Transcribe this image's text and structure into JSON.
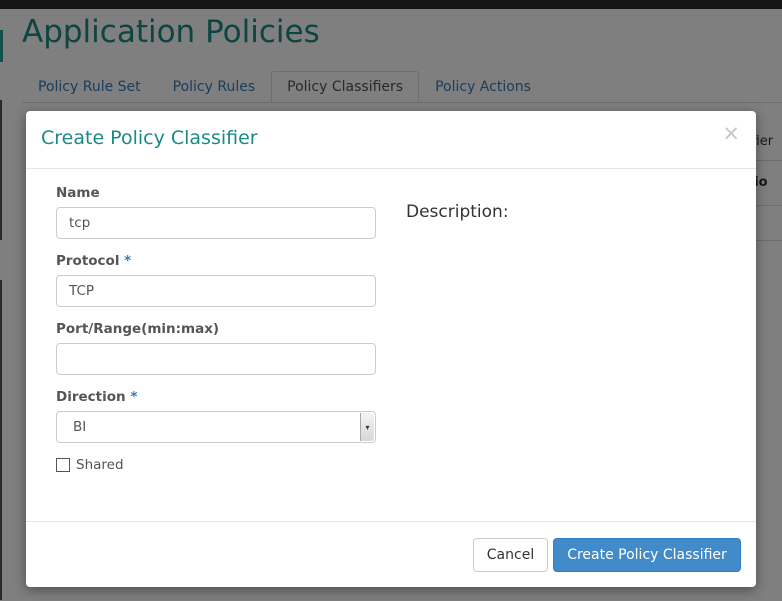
{
  "page": {
    "title": "Application Policies",
    "tabs": [
      {
        "label": "Policy Rule Set"
      },
      {
        "label": "Policy Rules"
      },
      {
        "label": "Policy Classifiers"
      },
      {
        "label": "Policy Actions"
      }
    ],
    "active_tab": "Policy Classifiers",
    "bg_table": {
      "cell_top": "ifier",
      "cell_header": "tio"
    }
  },
  "modal": {
    "title": "Create Policy Classifier",
    "close_glyph": "×",
    "fields": {
      "name": {
        "label": "Name",
        "value": "tcp"
      },
      "protocol": {
        "label": "Protocol",
        "required_mark": "*",
        "value": "TCP"
      },
      "port_range": {
        "label": "Port/Range(min:max)",
        "value": ""
      },
      "direction": {
        "label": "Direction",
        "required_mark": "*",
        "value": "BI"
      },
      "shared": {
        "label": "Shared",
        "checked": false
      }
    },
    "description": {
      "title": "Description:"
    },
    "buttons": {
      "cancel": "Cancel",
      "submit": "Create Policy Classifier"
    }
  },
  "colors": {
    "accent": "#1b8a87",
    "link": "#337ab7",
    "primary_button": "#428bca"
  }
}
